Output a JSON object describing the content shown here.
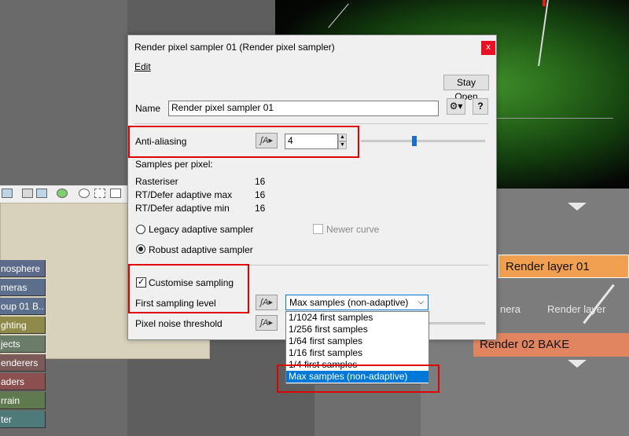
{
  "background": {
    "sidebar_tabs": [
      {
        "label": "nosphere",
        "color": "#5e6a8c"
      },
      {
        "label": "meras",
        "color": "#5b6f8d"
      },
      {
        "label": "oup 01 B...",
        "color": "#5d6f8e"
      },
      {
        "label": "ghting",
        "color": "#8f8a4a"
      },
      {
        "label": "jects",
        "color": "#6b7c6b"
      },
      {
        "label": "enderers",
        "color": "#7d5a5a"
      },
      {
        "label": "aders",
        "color": "#8b4f4f"
      },
      {
        "label": "rrain",
        "color": "#5f7a4f"
      },
      {
        "label": "ter",
        "color": "#4f7a7a"
      }
    ],
    "nodes": {
      "render_layer": {
        "label": "Render layer 01",
        "color": "#f0a050"
      },
      "render_bake": {
        "label": "Render 02 BAKE",
        "color": "#e08560"
      },
      "label_camera": "nera",
      "label_render_layer": "Render layer"
    }
  },
  "dialog": {
    "title": "Render pixel sampler 01    (Render pixel sampler)",
    "close_label": "x",
    "menu_edit": "Edit",
    "stay_open_label": "Stay Open",
    "name_label": "Name",
    "name_value": "Render pixel sampler 01",
    "help_label": "?",
    "anti_aliasing": {
      "label": "Anti-aliasing",
      "value": "4",
      "slider_fraction": 0.43
    },
    "samples_header": "Samples per pixel:",
    "samples": [
      {
        "label": "Rasteriser",
        "value": "16"
      },
      {
        "label": "RT/Defer adaptive max",
        "value": "16"
      },
      {
        "label": "RT/Defer adaptive min",
        "value": "16"
      }
    ],
    "legacy_sampler_label": "Legacy adaptive sampler",
    "newer_curve_label": "Newer curve",
    "robust_sampler_label": "Robust adaptive sampler",
    "customise_sampling_label": "Customise sampling",
    "first_sampling_level_label": "First sampling level",
    "pixel_noise_threshold_label": "Pixel noise threshold",
    "first_sampling_level_value": "Max samples (non-adaptive)",
    "dropdown_options": [
      "1/1024 first samples",
      "1/256 first samples",
      "1/64 first samples",
      "1/16 first samples",
      "1/4 first samples",
      "Max samples (non-adaptive)"
    ],
    "selected_option_index": 5
  },
  "colors": {
    "accent": "#0078d7",
    "annotation_red": "#e00000",
    "close_red": "#e81123"
  }
}
